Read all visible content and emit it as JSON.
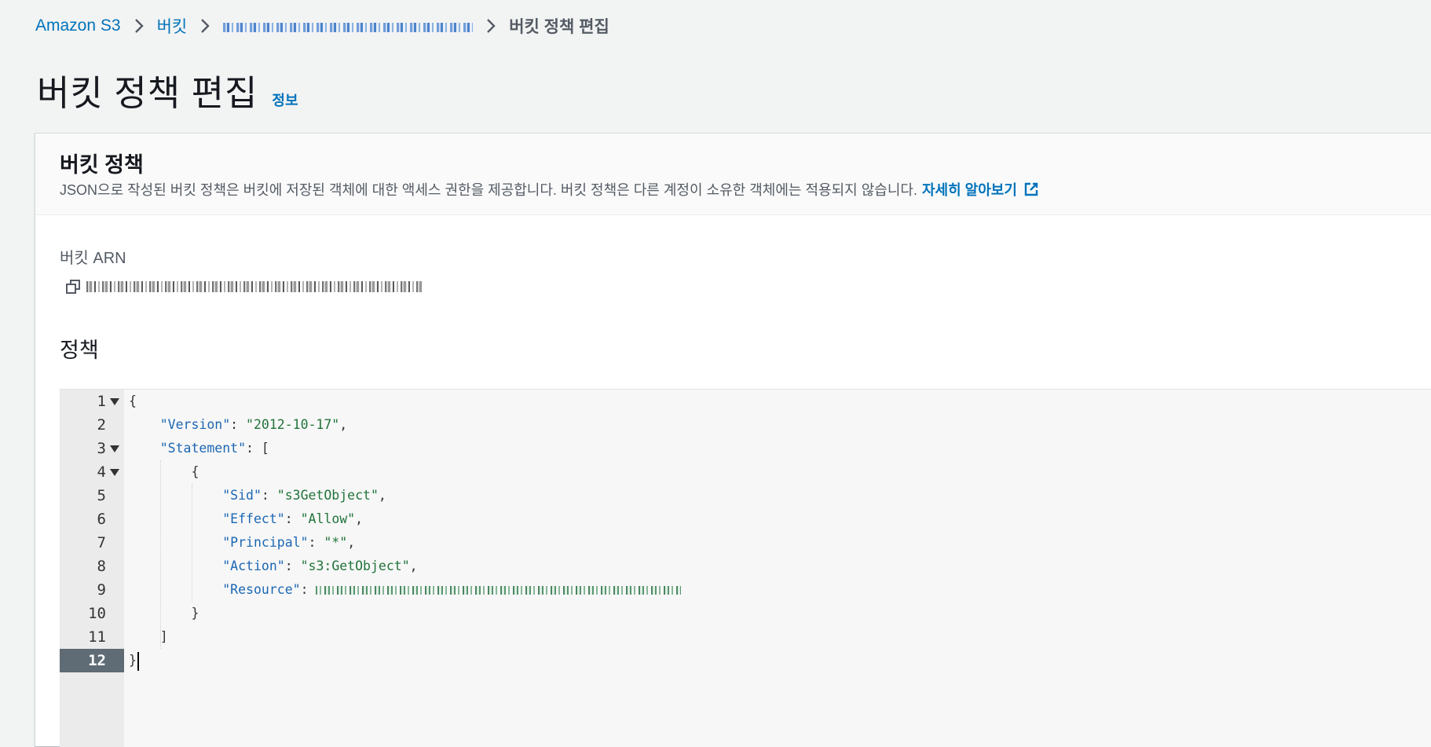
{
  "breadcrumb": {
    "items": [
      "Amazon S3",
      "버킷"
    ],
    "bucket_name_redacted": "",
    "current": "버킷 정책 편집"
  },
  "page": {
    "title": "버킷 정책 편집",
    "info_link": "정보"
  },
  "panel": {
    "heading": "버킷 정책",
    "description": "JSON으로 작성된 버킷 정책은 버킷에 저장된 객체에 대한 액세스 권한을 제공합니다. 버킷 정책은 다른 계정이 소유한 객체에는 적용되지 않습니다.",
    "learn_more": "자세히 알아보기",
    "arn_label": "버킷 ARN",
    "policy_label": "정책"
  },
  "editor": {
    "line_numbers": [
      "1",
      "2",
      "3",
      "4",
      "5",
      "6",
      "7",
      "8",
      "9",
      "10",
      "11",
      "12"
    ],
    "active_line": "12",
    "lines": {
      "l1": "{",
      "l2_key": "\"Version\"",
      "l2_val": "\"2012-10-17\"",
      "l3_key": "\"Statement\"",
      "l3_rest": ": [",
      "l4": "{",
      "l5_key": "\"Sid\"",
      "l5_val": "\"s3GetObject\"",
      "l6_key": "\"Effect\"",
      "l6_val": "\"Allow\"",
      "l7_key": "\"Principal\"",
      "l7_val": "\"*\"",
      "l8_key": "\"Action\"",
      "l8_val": "\"s3:GetObject\"",
      "l9_key": "\"Resource\"",
      "l10": "}",
      "l11": "]",
      "l12": "}"
    }
  },
  "colors": {
    "link": "#0073bb",
    "json_key": "#1b67b3",
    "json_string": "#21733a",
    "active_gutter": "#5f6b75"
  },
  "icons": [
    "chevron-right-icon",
    "external-link-icon",
    "copy-icon",
    "fold-arrow-icon"
  ]
}
